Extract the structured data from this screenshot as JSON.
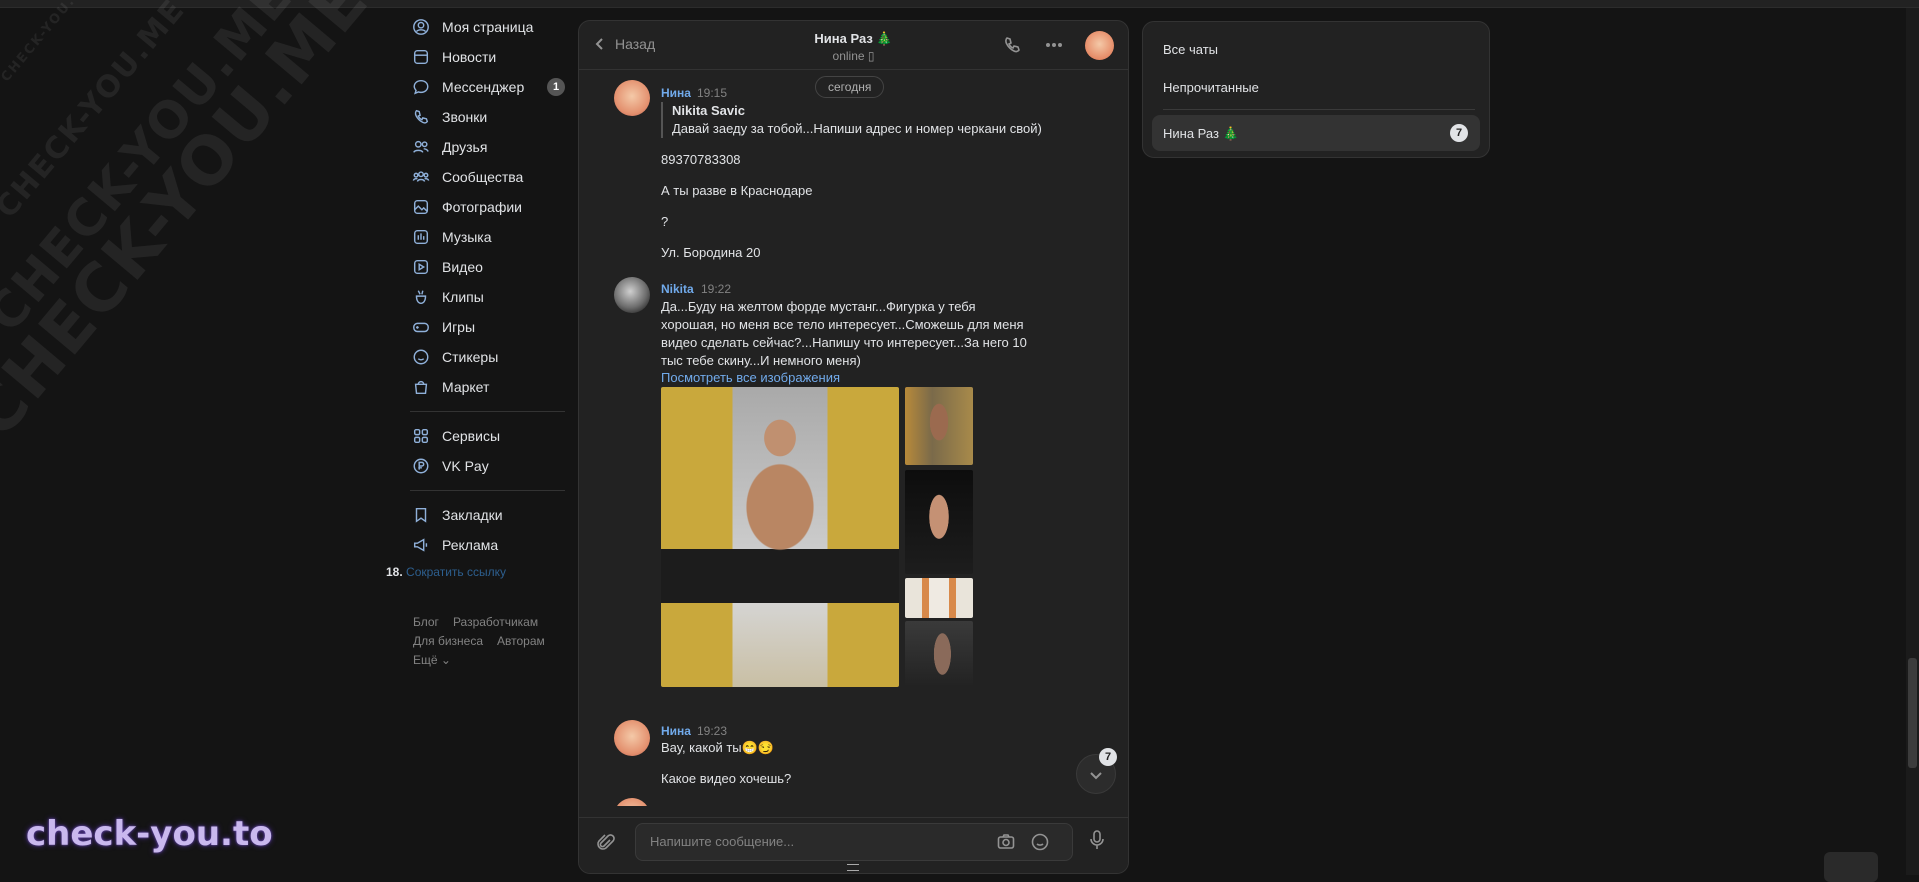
{
  "watermark": {
    "lines": [
      "CHECK-YOU.ME",
      "CHECK-YOU.ME",
      "CHECK-YOU.ME",
      "CHECK-YOU.ME"
    ],
    "brand": "check-you.to"
  },
  "nav": {
    "items": [
      {
        "label": "Моя страница",
        "icon": "user-circle-icon"
      },
      {
        "label": "Новости",
        "icon": "news-icon"
      },
      {
        "label": "Мессенджер",
        "icon": "message-icon",
        "badge": "1"
      },
      {
        "label": "Звонки",
        "icon": "phone-icon"
      },
      {
        "label": "Друзья",
        "icon": "friends-icon"
      },
      {
        "label": "Сообщества",
        "icon": "communities-icon"
      },
      {
        "label": "Фотографии",
        "icon": "photos-icon"
      },
      {
        "label": "Музыка",
        "icon": "music-icon"
      },
      {
        "label": "Видео",
        "icon": "video-icon"
      },
      {
        "label": "Клипы",
        "icon": "clips-icon"
      },
      {
        "label": "Игры",
        "icon": "games-icon"
      },
      {
        "label": "Стикеры",
        "icon": "stickers-icon"
      },
      {
        "label": "Маркет",
        "icon": "market-icon"
      }
    ],
    "items2": [
      {
        "label": "Сервисы",
        "icon": "services-icon"
      },
      {
        "label": "VK Pay",
        "icon": "vkpay-icon"
      }
    ],
    "items3": [
      {
        "label": "Закладки",
        "icon": "bookmark-icon"
      },
      {
        "label": "Реклама",
        "icon": "ads-icon"
      }
    ],
    "shortlink_num": "18.",
    "shortlink_label": "Сократить ссылку",
    "footer": {
      "blog": "Блог",
      "devs": "Разработчикам",
      "business": "Для бизнеса",
      "authors": "Авторам",
      "more": "Ещё ⌄"
    }
  },
  "chat": {
    "back_label": "Назад",
    "peer_name": "Нина Раз 🎄",
    "peer_status": "online ▯",
    "date_divider": "сегодня",
    "messages": [
      {
        "author": "Нина",
        "time": "19:15",
        "reply_author": "Nikita Savic",
        "reply_text": "Давай заеду за тобой...Напиши адрес и номер черкани свой)",
        "lines": [
          "89370783308",
          "А ты разве в Краснодаре",
          "?",
          "Ул. Бородина 20"
        ]
      },
      {
        "author": "Nikita",
        "time": "19:22",
        "text": "Да...Буду на желтом форде мустанг...Фигурка у тебя хорошая, но меня все тело интересует...Сможешь для меня видео сделать сейчас?...Напишу что интересует...За него 10 тыс тебе скину...И немного меня)",
        "link": "Посмотреть все изображения"
      },
      {
        "author": "Нина",
        "time": "19:23",
        "lines": [
          "Вау, какой ты😁😏",
          "Какое видео хочешь?"
        ]
      }
    ],
    "unread_count": "7",
    "composer_placeholder": "Напишите сообщение..."
  },
  "folders": {
    "all": "Все чаты",
    "unread": "Непрочитанные",
    "active_label": "Нина Раз 🎄",
    "active_count": "7"
  }
}
